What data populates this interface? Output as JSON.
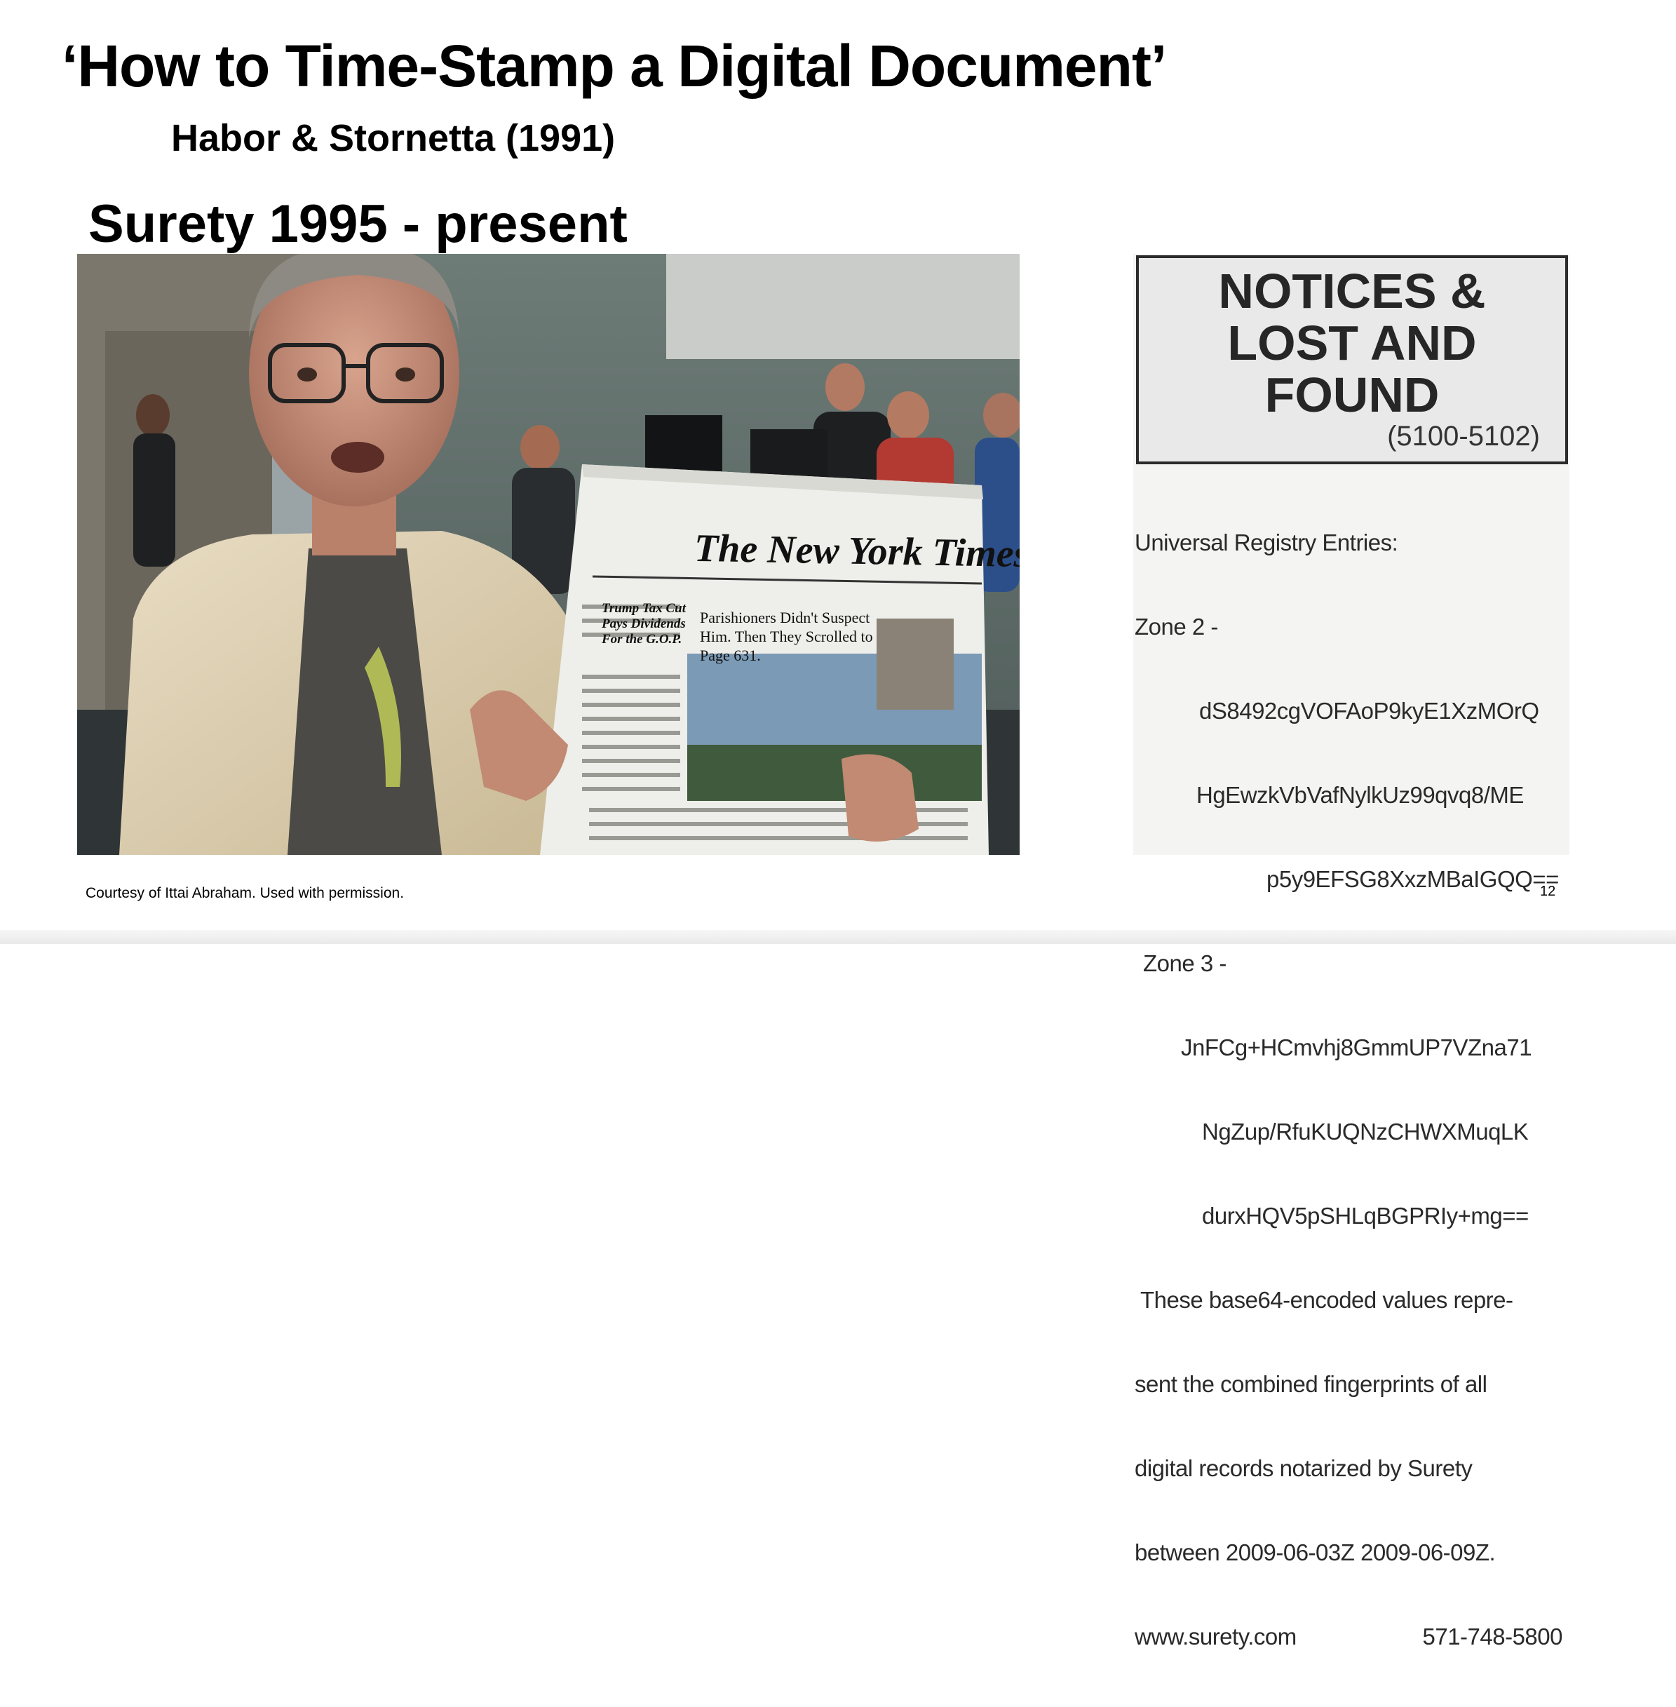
{
  "slide": {
    "title": "‘How to Time-Stamp a Digital Document’",
    "subtitle": "Habor & Stornetta (1991)",
    "heading": "Surety 1995 - present",
    "footer": "Courtesy of Ittai Abraham. Used with permission.",
    "page_number": "12"
  },
  "photo": {
    "newspaper_masthead": "The New York Times",
    "headline_left": "Trump Tax Cut Pays Dividends For the G.O.P.",
    "headline_main": "Parishioners Didn't Suspect Him. Then They Scrolled to Page 631."
  },
  "notice": {
    "header_lines": [
      "NOTICES &",
      "LOST AND",
      "FOUND"
    ],
    "code": "(5100-5102)",
    "label_registry": "Universal Registry Entries:",
    "zone2_label": "Zone 2 -",
    "zone2_lines": [
      "dS8492cgVOFAoP9kyE1XzMOrQ",
      "HgEwzkVbVafNylkUz99qvq8/ME",
      "p5y9EFSG8XxzMBaIGQQ=="
    ],
    "zone3_label": "Zone 3 -",
    "zone3_lines": [
      "JnFCg+HCmvhj8GmmUP7VZna71",
      "NgZup/RfuKUQNzCHWXMuqLK",
      "durxHQV5pSHLqBGPRIy+mg=="
    ],
    "description_lines": [
      "These base64-encoded values repre-",
      "sent the combined fingerprints of all",
      "digital records notarized by Surety",
      "between 2009-06-03Z 2009-06-09Z."
    ],
    "website": "www.surety.com",
    "phone": "571-748-5800"
  },
  "colors": {
    "background": "#ffffff",
    "text": "#000000",
    "notice_border": "#2b2b2b"
  }
}
